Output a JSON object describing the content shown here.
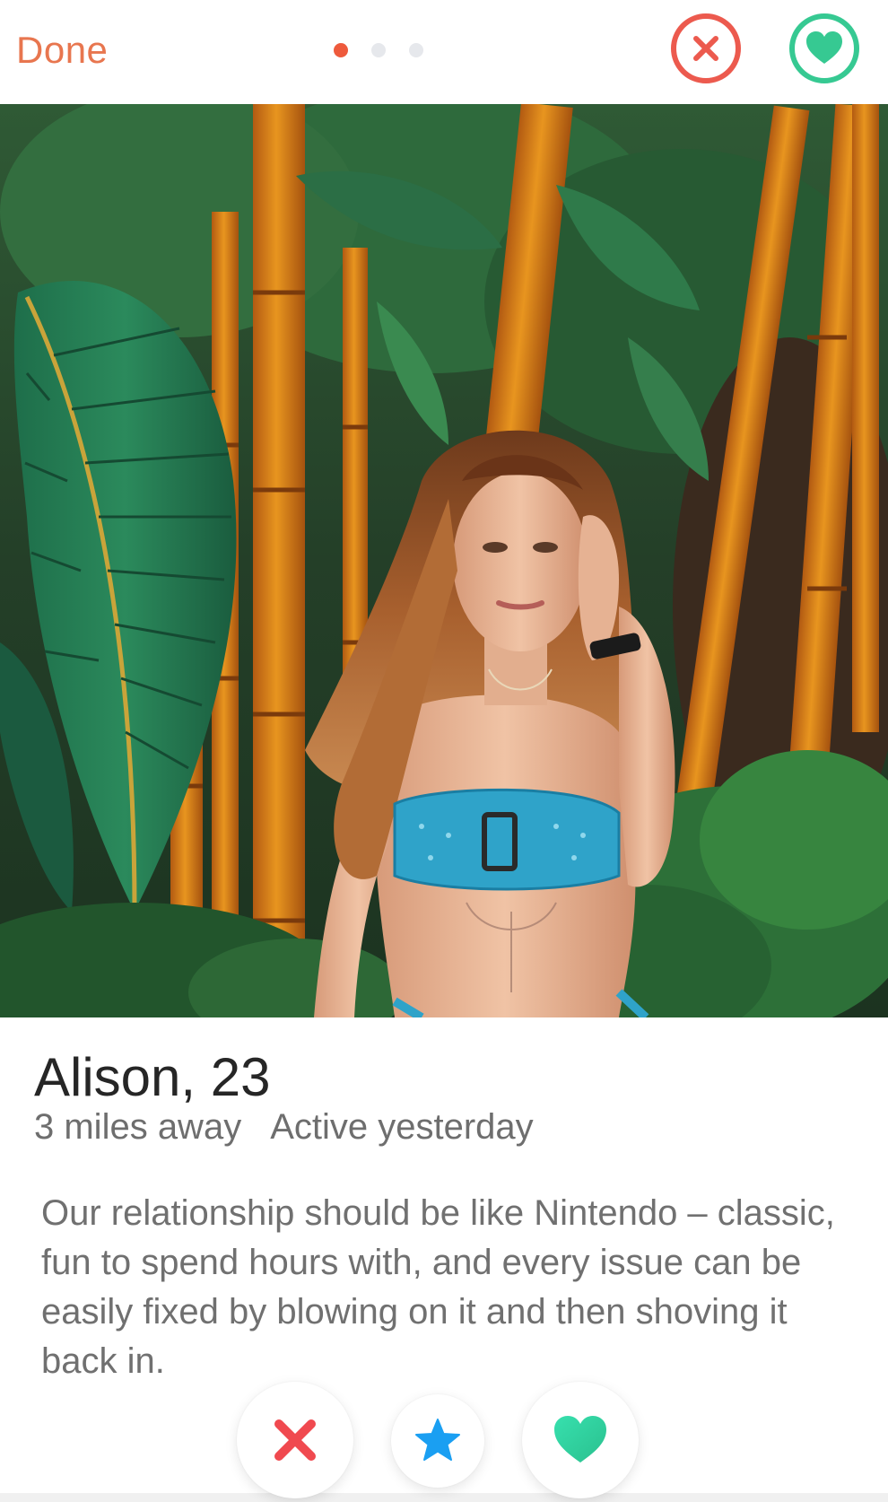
{
  "header": {
    "done_label": "Done",
    "photo_count": 3,
    "active_photo": 1,
    "accent_color": "#ee5a3c",
    "nope_icon": "close-icon",
    "like_icon": "heart-icon"
  },
  "profile": {
    "name_age": "Alison, 23",
    "distance": "3 miles away",
    "activity": "Active yesterday",
    "bio": "Our relationship should be like Nintendo – classic, fun to spend hours with, and every issue can be easily fixed by blowing on it and then shoving it back in."
  },
  "actions": {
    "nope_icon": "x-icon",
    "nope_color": "#f0494f",
    "super_like_icon": "star-icon",
    "super_like_color": "#1a9ff2",
    "like_icon": "heart-icon",
    "like_color": "#3ad9a5"
  }
}
